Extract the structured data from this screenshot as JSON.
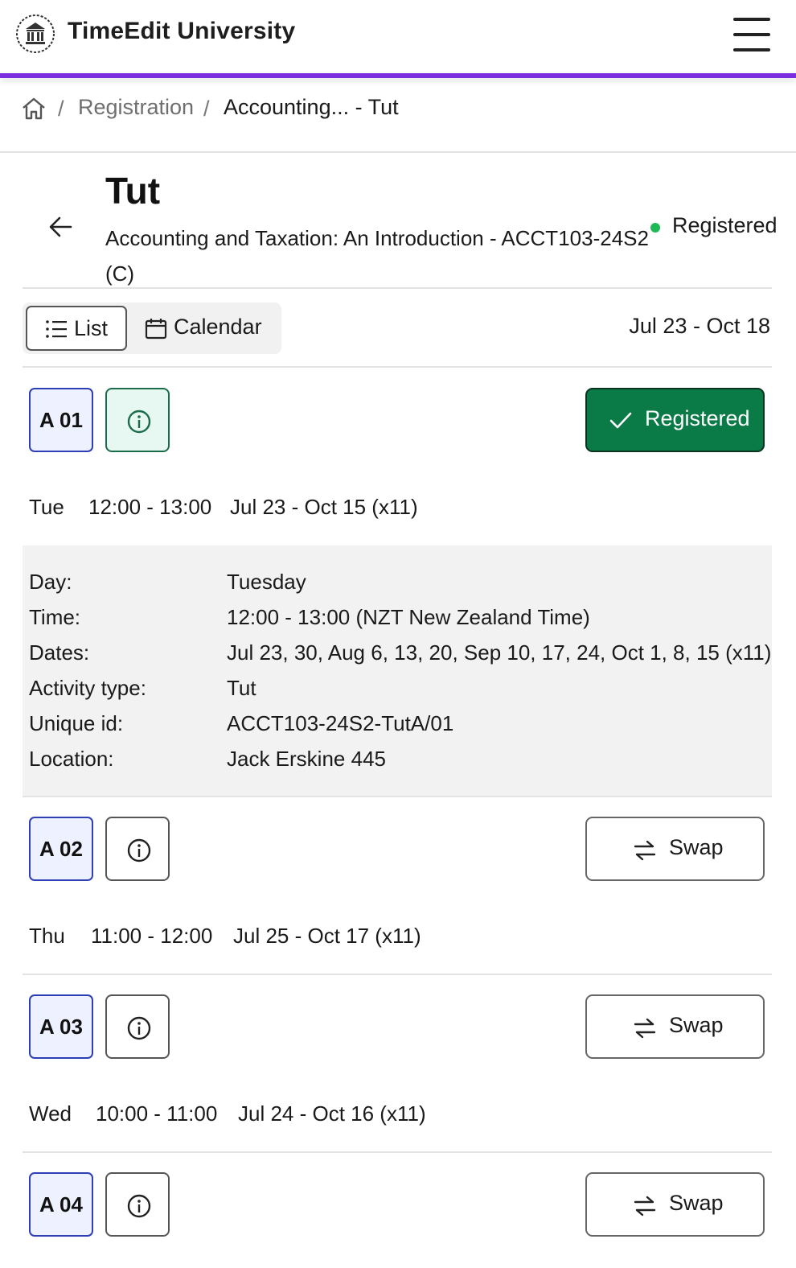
{
  "header": {
    "brand": "TimeEdit University",
    "logo_icon": "university-seal-icon",
    "menu_icon": "hamburger-menu-icon",
    "accent_color": "#7b2ee0"
  },
  "breadcrumb": {
    "home_icon": "home-icon",
    "separator": "/",
    "items": [
      "Registration",
      "Accounting... - Tut"
    ]
  },
  "activity": {
    "title": "Tut",
    "subtitle": "Accounting and Taxation: An Introduction - ACCT103-24S2 (C)",
    "status": "Registered",
    "status_color": "#1db954"
  },
  "view": {
    "list_label": "List",
    "calendar_label": "Calendar",
    "date_range": "Jul 23 - Oct 18"
  },
  "groups": [
    {
      "code": "A 01",
      "action": "Registered",
      "day": "Tue",
      "time": "12:00 - 13:00",
      "dates": "Jul 23 - Oct 15 (x11)",
      "details": [
        {
          "label": "Day:",
          "value": "Tuesday"
        },
        {
          "label": "Time:",
          "value": "12:00 - 13:00 (NZT New Zealand Time)"
        },
        {
          "label": "Dates:",
          "value": "Jul 23, 30, Aug 6, 13, 20, Sep 10, 17, 24, Oct 1, 8, 15 (x11)"
        },
        {
          "label": "Activity type:",
          "value": "Tut"
        },
        {
          "label": "Unique id:",
          "value": "ACCT103-24S2-TutA/01"
        },
        {
          "label": "Location:",
          "value": "Jack Erskine 445"
        }
      ]
    },
    {
      "code": "A 02",
      "action": "Swap",
      "day": "Thu",
      "time": "11:00 - 12:00",
      "dates": "Jul 25 - Oct 17 (x11)"
    },
    {
      "code": "A 03",
      "action": "Swap",
      "day": "Wed",
      "time": "10:00 - 11:00",
      "dates": "Jul 24 - Oct 16 (x11)"
    },
    {
      "code": "A 04",
      "action": "Swap"
    }
  ],
  "colors": {
    "registered_button": "#0a7a46",
    "group_badge_border": "#2d3fb5",
    "group_badge_bg": "#eef1ff"
  }
}
